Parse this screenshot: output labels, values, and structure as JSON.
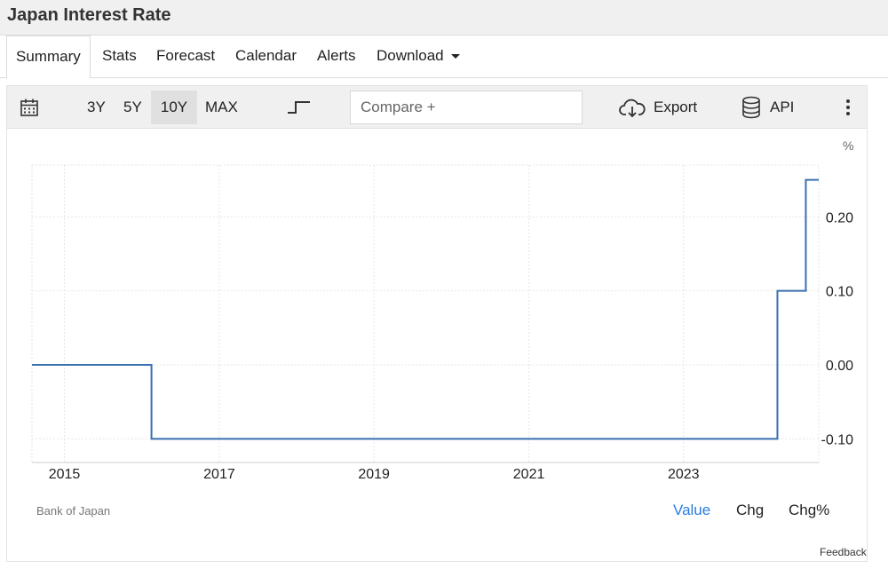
{
  "page": {
    "title": "Japan Interest Rate"
  },
  "tabs": [
    {
      "label": "Summary",
      "active": true
    },
    {
      "label": "Stats"
    },
    {
      "label": "Forecast"
    },
    {
      "label": "Calendar"
    },
    {
      "label": "Alerts"
    },
    {
      "label": "Download",
      "dropdown": true
    }
  ],
  "toolbar": {
    "ranges": [
      "3Y",
      "5Y",
      "10Y",
      "MAX"
    ],
    "active_range": "10Y",
    "compare_placeholder": "Compare +",
    "export_label": "Export",
    "api_label": "API",
    "icons": [
      "calendar-icon",
      "step-line-icon",
      "cloud-download-icon",
      "database-icon",
      "more-vertical-icon"
    ]
  },
  "colors": {
    "line": "#3a6fb0",
    "accent": "#2a7de1",
    "grid": "#e6e6e6"
  },
  "chart_data": {
    "type": "line",
    "step": true,
    "unit_label": "%",
    "x_ticks": [
      "2015",
      "2017",
      "2019",
      "2021",
      "2023"
    ],
    "y_ticks": [
      "0.20",
      "0.10",
      "0.00",
      "-0.10"
    ],
    "xlim": [
      "2014-08-01",
      "2024-09-30"
    ],
    "ylim": [
      -0.132,
      0.27
    ],
    "grid": true,
    "series": [
      {
        "points": [
          {
            "date": "2014-08-01",
            "value": 0.0
          },
          {
            "date": "2016-02-16",
            "value": -0.1
          },
          {
            "date": "2024-03-19",
            "value": 0.1
          },
          {
            "date": "2024-07-31",
            "value": 0.25
          }
        ]
      }
    ]
  },
  "footer": {
    "source": "Bank of Japan",
    "modes": [
      "Value",
      "Chg",
      "Chg%"
    ],
    "active_mode": "Value",
    "feedback": "Feedback"
  }
}
